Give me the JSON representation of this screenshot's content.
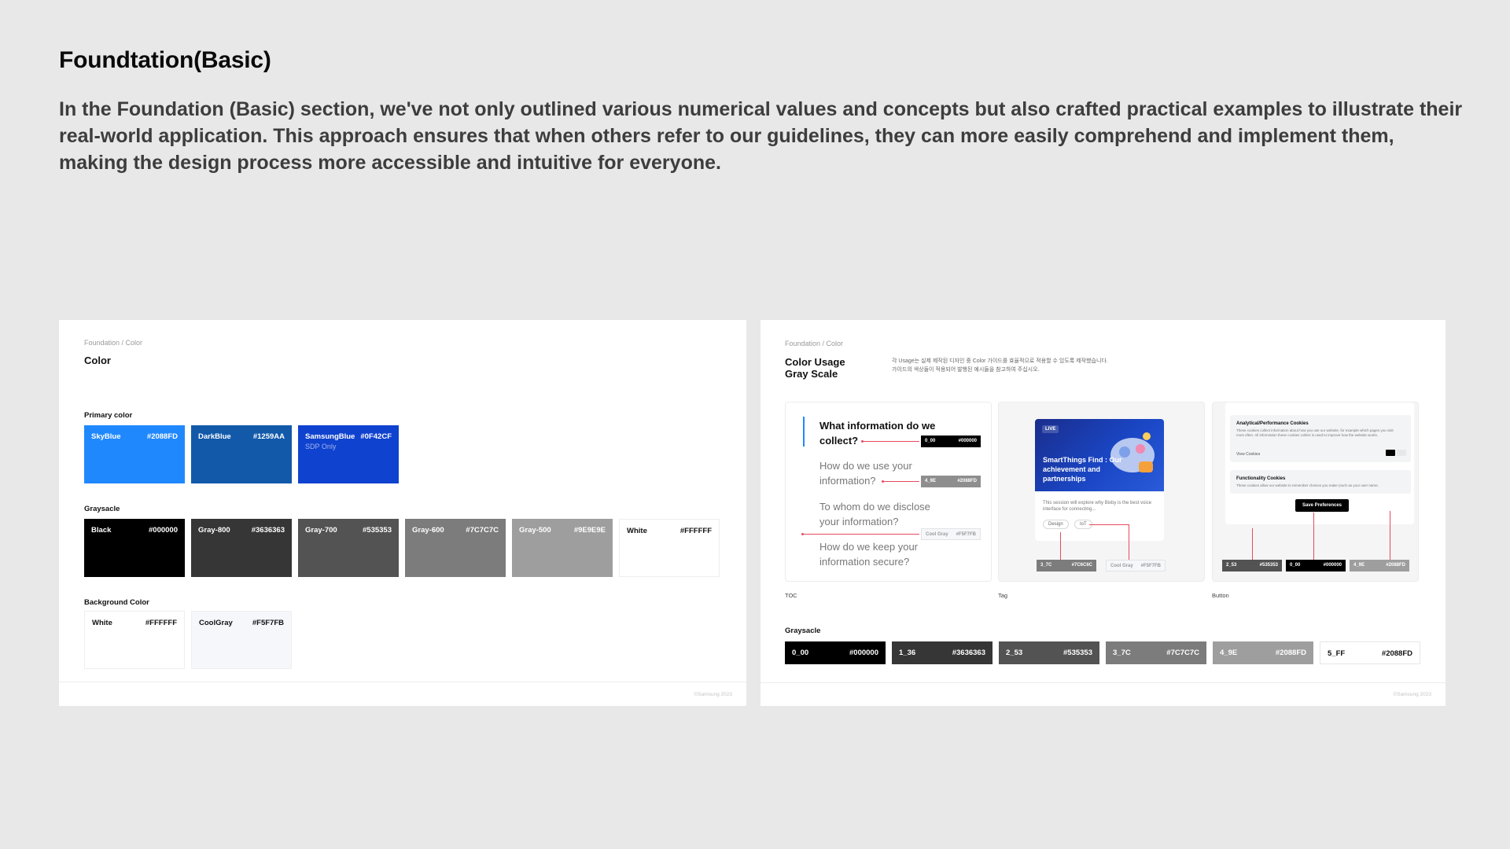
{
  "page": {
    "title": "Foundtation(Basic)",
    "intro": "In the Foundation (Basic) section, we've not only outlined various numerical values and concepts but also crafted practical examples to illustrate their real-world application. This approach ensures that when others refer to our guidelines, they can more easily comprehend and implement them, making the design process more accessible and intuitive for everyone."
  },
  "left_panel": {
    "breadcrumb": "Foundation / Color",
    "title": "Color",
    "primary_label": "Primary color",
    "primary": [
      {
        "name": "SkyBlue",
        "hex": "#2088FD",
        "color": "#2088fd",
        "sub": ""
      },
      {
        "name": "DarkBlue",
        "hex": "#1259AA",
        "color": "#1259aa",
        "sub": ""
      },
      {
        "name": "SamsungBlue",
        "hex": "#0F42CF",
        "color": "#0f42cf",
        "sub": "SDP Only"
      }
    ],
    "grayscale_label": "Graysacle",
    "grayscale": [
      {
        "name": "Black",
        "hex": "#000000",
        "color": "#000000"
      },
      {
        "name": "Gray-800",
        "hex": "#3636363",
        "color": "#363636"
      },
      {
        "name": "Gray-700",
        "hex": "#535353",
        "color": "#535353"
      },
      {
        "name": "Gray-600",
        "hex": "#7C7C7C",
        "color": "#7c7c7c"
      },
      {
        "name": "Gray-500",
        "hex": "#9E9E9E",
        "color": "#9e9e9e"
      },
      {
        "name": "White",
        "hex": "#FFFFFF",
        "color": "#ffffff"
      }
    ],
    "background_label": "Background Color",
    "background": [
      {
        "name": "White",
        "hex": "#FFFFFF",
        "color": "#ffffff"
      },
      {
        "name": "CoolGray",
        "hex": "#F5F7FB",
        "color": "#f5f7fb"
      }
    ],
    "copyright": "©Samsung 2023"
  },
  "right_panel": {
    "breadcrumb": "Foundation / Color",
    "title_line1": "Color Usage",
    "title_line2": "Gray Scale",
    "desc_line1": "각 Usage는 실제 제작된 디자인 중 Color 가이드를 효율적으로 적용할 수 있도록 제작했습니다.",
    "desc_line2": "가이드의 색상들이 적용되어 발행된 예시들을 참고하여 주십시오.",
    "toc": {
      "label": "TOC",
      "items": [
        "What information do we collect?",
        "How do we use your information?",
        "To whom do we disclose your information?",
        "How do we keep your information secure?"
      ],
      "pill1_a": "0_00",
      "pill1_b": "#000000",
      "pill2_a": "4_9E",
      "pill2_b": "#2088FD",
      "pill3_a": "Cool Gray",
      "pill3_b": "#F5F7FB"
    },
    "tag": {
      "label": "Tag",
      "live": "LIVE",
      "hero_text": "SmartThings Find : Our achievement and partnerships",
      "desc": "This session will explore why Bixby is the best voice interface for connecting...",
      "chip1": "Design",
      "chip2": "IoT",
      "pill1_a": "3_7C",
      "pill1_b": "#7C6C6C",
      "pill2_a": "Cool Gray",
      "pill2_b": "#F5F7FB"
    },
    "button": {
      "label": "Button",
      "cookie1_title": "Analytical/Performance Cookies",
      "cookie1_text": "These cookies collect information about how you use our website, for example which pages you visit most often. All information these cookies collect is used to improve how the website works.",
      "view_cookies": "View Cookies",
      "cookie2_title": "Functionality Cookies",
      "cookie2_text": "These cookies allow our website to remember choices you make (such as your user name, language or the region you are in) and provide more enhanced features.",
      "save": "Save Preferences",
      "pill1_a": "2_53",
      "pill1_b": "#535353",
      "pill2_a": "0_00",
      "pill2_b": "#000000",
      "pill3_a": "4_9E",
      "pill3_b": "#2088FD"
    },
    "grayscale_label": "Graysacle",
    "grayscale": [
      {
        "name": "0_00",
        "hex": "#000000",
        "color": "#000000"
      },
      {
        "name": "1_36",
        "hex": "#3636363",
        "color": "#363636"
      },
      {
        "name": "2_53",
        "hex": "#535353",
        "color": "#535353"
      },
      {
        "name": "3_7C",
        "hex": "#7C7C7C",
        "color": "#7c7c7c"
      },
      {
        "name": "4_9E",
        "hex": "#2088FD",
        "color": "#9e9e9e"
      },
      {
        "name": "5_FF",
        "hex": "#2088FD",
        "color": "#ffffff"
      }
    ],
    "copyright": "©Samsung 2023"
  }
}
